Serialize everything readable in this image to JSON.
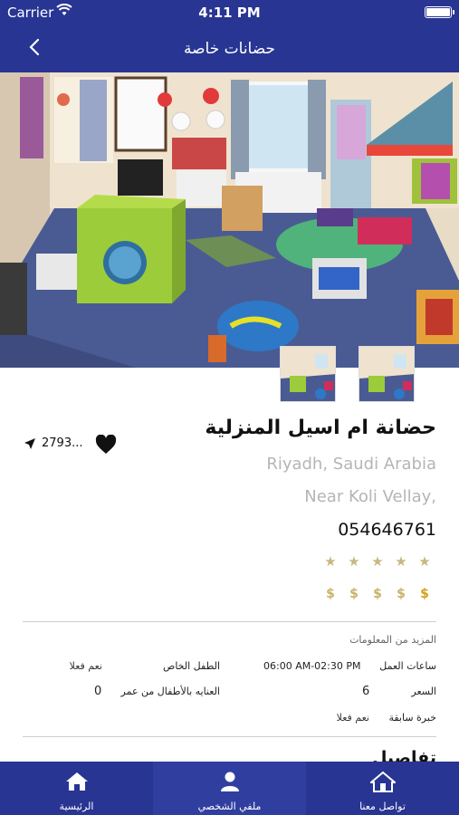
{
  "status_bar": {
    "carrier": "Carrier",
    "time": "4:11 PM"
  },
  "nav": {
    "title": "حضانات خاصة"
  },
  "nursery": {
    "name": "حضانة ام اسيل المنزلية",
    "city": "Riyadh, Saudi Arabia",
    "address": "Near Koli Vellay,",
    "phone": "054646761",
    "distance": "2793...",
    "rating_stars": 5,
    "price_level": 5
  },
  "more_info": {
    "title": "المزيد من المعلومات",
    "rows": [
      {
        "label": "ساعات العمل",
        "value": "06:00 AM-02:30 PM",
        "label2": "الطفل الخاص",
        "value2": "نعم فعلا"
      },
      {
        "label": "السعر",
        "value": "6",
        "label2": "العنايه بالأطفال من عمر",
        "value2": "0"
      },
      {
        "label": "خبرة سابقة",
        "value": "نعم فعلا"
      }
    ]
  },
  "details": {
    "title": "تفاصيل"
  },
  "tabs": [
    {
      "label": "الرئيسية",
      "icon": "home-icon"
    },
    {
      "label": "ملفي الشخصي",
      "icon": "profile-icon"
    },
    {
      "label": "تواصل معنا",
      "icon": "contact-home-icon"
    }
  ],
  "colors": {
    "primary": "#283593",
    "tab_active": "#303f9f",
    "muted_text": "#b5b5b5",
    "star": "#c7b784",
    "price": "#d4a017"
  }
}
